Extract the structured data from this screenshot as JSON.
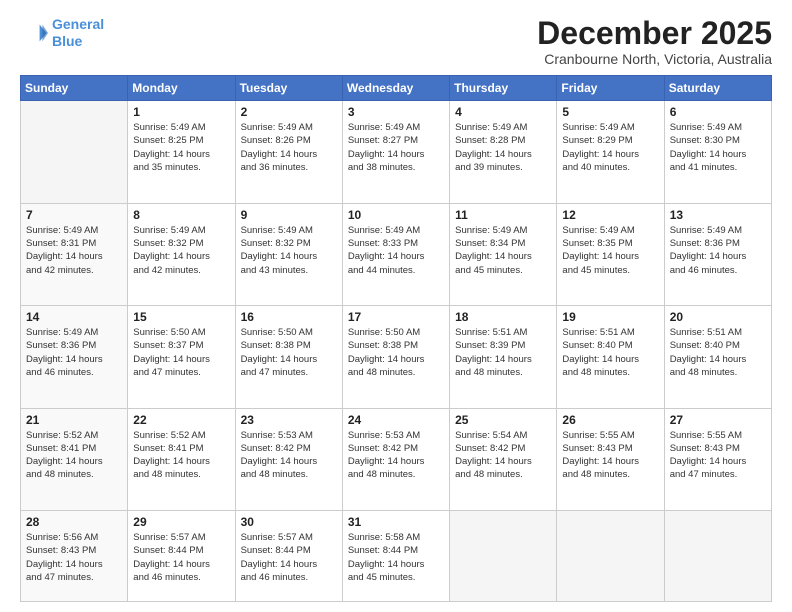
{
  "header": {
    "logo_line1": "General",
    "logo_line2": "Blue",
    "month_year": "December 2025",
    "location": "Cranbourne North, Victoria, Australia"
  },
  "weekdays": [
    "Sunday",
    "Monday",
    "Tuesday",
    "Wednesday",
    "Thursday",
    "Friday",
    "Saturday"
  ],
  "weeks": [
    [
      {
        "day": "",
        "info": ""
      },
      {
        "day": "1",
        "info": "Sunrise: 5:49 AM\nSunset: 8:25 PM\nDaylight: 14 hours\nand 35 minutes."
      },
      {
        "day": "2",
        "info": "Sunrise: 5:49 AM\nSunset: 8:26 PM\nDaylight: 14 hours\nand 36 minutes."
      },
      {
        "day": "3",
        "info": "Sunrise: 5:49 AM\nSunset: 8:27 PM\nDaylight: 14 hours\nand 38 minutes."
      },
      {
        "day": "4",
        "info": "Sunrise: 5:49 AM\nSunset: 8:28 PM\nDaylight: 14 hours\nand 39 minutes."
      },
      {
        "day": "5",
        "info": "Sunrise: 5:49 AM\nSunset: 8:29 PM\nDaylight: 14 hours\nand 40 minutes."
      },
      {
        "day": "6",
        "info": "Sunrise: 5:49 AM\nSunset: 8:30 PM\nDaylight: 14 hours\nand 41 minutes."
      }
    ],
    [
      {
        "day": "7",
        "info": "Sunrise: 5:49 AM\nSunset: 8:31 PM\nDaylight: 14 hours\nand 42 minutes."
      },
      {
        "day": "8",
        "info": "Sunrise: 5:49 AM\nSunset: 8:32 PM\nDaylight: 14 hours\nand 42 minutes."
      },
      {
        "day": "9",
        "info": "Sunrise: 5:49 AM\nSunset: 8:32 PM\nDaylight: 14 hours\nand 43 minutes."
      },
      {
        "day": "10",
        "info": "Sunrise: 5:49 AM\nSunset: 8:33 PM\nDaylight: 14 hours\nand 44 minutes."
      },
      {
        "day": "11",
        "info": "Sunrise: 5:49 AM\nSunset: 8:34 PM\nDaylight: 14 hours\nand 45 minutes."
      },
      {
        "day": "12",
        "info": "Sunrise: 5:49 AM\nSunset: 8:35 PM\nDaylight: 14 hours\nand 45 minutes."
      },
      {
        "day": "13",
        "info": "Sunrise: 5:49 AM\nSunset: 8:36 PM\nDaylight: 14 hours\nand 46 minutes."
      }
    ],
    [
      {
        "day": "14",
        "info": "Sunrise: 5:49 AM\nSunset: 8:36 PM\nDaylight: 14 hours\nand 46 minutes."
      },
      {
        "day": "15",
        "info": "Sunrise: 5:50 AM\nSunset: 8:37 PM\nDaylight: 14 hours\nand 47 minutes."
      },
      {
        "day": "16",
        "info": "Sunrise: 5:50 AM\nSunset: 8:38 PM\nDaylight: 14 hours\nand 47 minutes."
      },
      {
        "day": "17",
        "info": "Sunrise: 5:50 AM\nSunset: 8:38 PM\nDaylight: 14 hours\nand 48 minutes."
      },
      {
        "day": "18",
        "info": "Sunrise: 5:51 AM\nSunset: 8:39 PM\nDaylight: 14 hours\nand 48 minutes."
      },
      {
        "day": "19",
        "info": "Sunrise: 5:51 AM\nSunset: 8:40 PM\nDaylight: 14 hours\nand 48 minutes."
      },
      {
        "day": "20",
        "info": "Sunrise: 5:51 AM\nSunset: 8:40 PM\nDaylight: 14 hours\nand 48 minutes."
      }
    ],
    [
      {
        "day": "21",
        "info": "Sunrise: 5:52 AM\nSunset: 8:41 PM\nDaylight: 14 hours\nand 48 minutes."
      },
      {
        "day": "22",
        "info": "Sunrise: 5:52 AM\nSunset: 8:41 PM\nDaylight: 14 hours\nand 48 minutes."
      },
      {
        "day": "23",
        "info": "Sunrise: 5:53 AM\nSunset: 8:42 PM\nDaylight: 14 hours\nand 48 minutes."
      },
      {
        "day": "24",
        "info": "Sunrise: 5:53 AM\nSunset: 8:42 PM\nDaylight: 14 hours\nand 48 minutes."
      },
      {
        "day": "25",
        "info": "Sunrise: 5:54 AM\nSunset: 8:42 PM\nDaylight: 14 hours\nand 48 minutes."
      },
      {
        "day": "26",
        "info": "Sunrise: 5:55 AM\nSunset: 8:43 PM\nDaylight: 14 hours\nand 48 minutes."
      },
      {
        "day": "27",
        "info": "Sunrise: 5:55 AM\nSunset: 8:43 PM\nDaylight: 14 hours\nand 47 minutes."
      }
    ],
    [
      {
        "day": "28",
        "info": "Sunrise: 5:56 AM\nSunset: 8:43 PM\nDaylight: 14 hours\nand 47 minutes."
      },
      {
        "day": "29",
        "info": "Sunrise: 5:57 AM\nSunset: 8:44 PM\nDaylight: 14 hours\nand 46 minutes."
      },
      {
        "day": "30",
        "info": "Sunrise: 5:57 AM\nSunset: 8:44 PM\nDaylight: 14 hours\nand 46 minutes."
      },
      {
        "day": "31",
        "info": "Sunrise: 5:58 AM\nSunset: 8:44 PM\nDaylight: 14 hours\nand 45 minutes."
      },
      {
        "day": "",
        "info": ""
      },
      {
        "day": "",
        "info": ""
      },
      {
        "day": "",
        "info": ""
      }
    ]
  ]
}
